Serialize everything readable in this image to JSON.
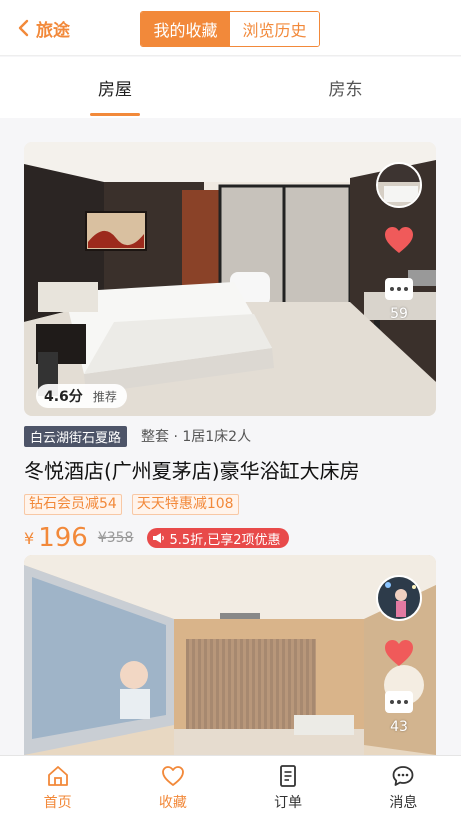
{
  "header": {
    "back_label": "旅途",
    "segments": [
      "我的收藏",
      "浏览历史"
    ]
  },
  "tabs": [
    "房屋",
    "房东"
  ],
  "listings": [
    {
      "rating": "4.6分",
      "rating_tag": "推荐",
      "comments": "59",
      "location": "白云湖街石夏路",
      "room_desc": "整套 · 1居1床2人",
      "title": "冬悦酒店(广州夏茅店)豪华浴缸大床房",
      "tags": [
        "钻石会员减54",
        "天天特惠减108"
      ],
      "currency": "¥",
      "price": "196",
      "original_price": "¥358",
      "discount": "5.5折,已享2项优惠"
    },
    {
      "comments": "43"
    }
  ],
  "bottom_nav": [
    "首页",
    "收藏",
    "订单",
    "消息"
  ],
  "colors": {
    "accent": "#f2893a",
    "discount": "#e84a4a",
    "location_badge": "#4d5468",
    "heart": "#f05a5a"
  }
}
